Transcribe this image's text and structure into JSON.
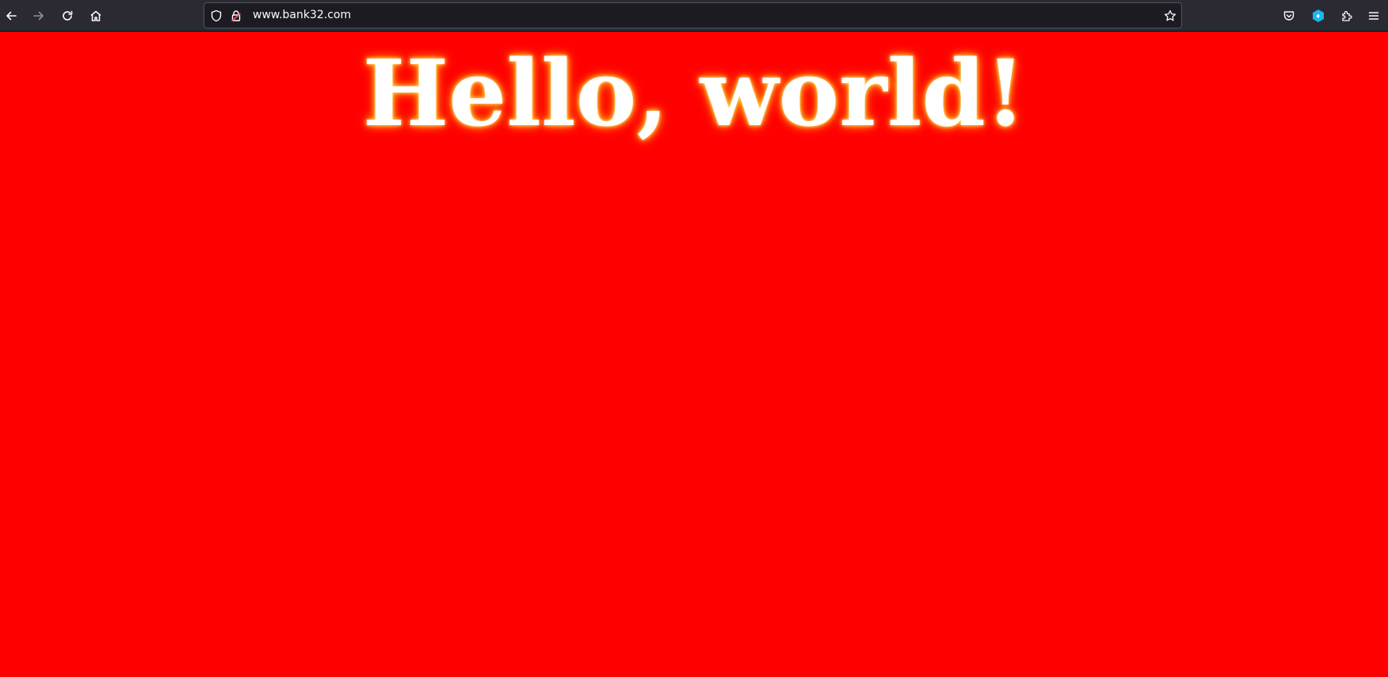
{
  "browser": {
    "url": "www.bank32.com",
    "icons": {
      "back": "back-arrow-icon",
      "forward": "forward-arrow-icon",
      "reload": "reload-icon",
      "home": "home-icon",
      "tracking_protection": "shield-icon",
      "connection": "lock-icon",
      "bookmark": "star-icon",
      "pocket": "pocket-icon",
      "extension": "extension-icon",
      "extensions_menu": "puzzle-icon",
      "app_menu": "hamburger-menu-icon"
    }
  },
  "page": {
    "heading": "Hello, world!",
    "background_color": "#ff0000",
    "heading_color": "#ffffff",
    "glow_color": "#ffa500"
  }
}
